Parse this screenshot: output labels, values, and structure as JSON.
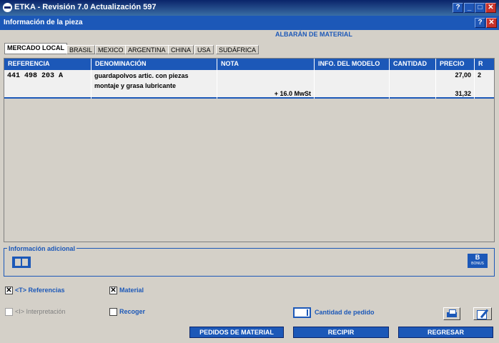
{
  "window": {
    "title": "ETKA - Revisión 7.0 Actualización 597",
    "help": "?",
    "minimize": "_",
    "maximize": "□",
    "close": "✕"
  },
  "dialog": {
    "title": "Información de la pieza",
    "help": "?",
    "close": "✕"
  },
  "section_title": "ALBARÁN DE MATERIAL",
  "tabs": [
    "MERCADO LOCAL",
    "BRASIL",
    "MEXICO",
    "ARGENTINA",
    "CHINA",
    "USA",
    "SUDÁFRICA"
  ],
  "table": {
    "headers": [
      "REFERENCIA",
      "DENOMINACIÓN",
      "NOTA",
      "INFO. DEL MODELO",
      "CANTIDAD",
      "PRECIO",
      "R"
    ],
    "row": {
      "referencia": "441 498 203 A",
      "denominacion_1": "guardapolvos artic. con piezas",
      "denominacion_2": "montaje y grasa lubricante",
      "nota": "+ 16.0 MwSt",
      "info_modelo": "",
      "cantidad": "",
      "precio": "27,00",
      "precio_total": "31,32",
      "r": "2"
    }
  },
  "info_adicional": {
    "label": "Información adicional",
    "bonus": "BONUS"
  },
  "options": {
    "referencias": {
      "label": "<T> Referencias",
      "checked": true
    },
    "material": {
      "label": "Material",
      "checked": true
    },
    "interpretacion": {
      "label": "<I> Interpretación",
      "checked": false
    },
    "recoger": {
      "label": "Recoger",
      "checked": false
    },
    "cantidad_pedido": "Cantidad de pedido"
  },
  "buttons": {
    "pedidos": "PEDIDOS DE MATERIAL",
    "recipir": "RECIPIR",
    "regresar": "REGRESAR"
  },
  "colors": {
    "accent": "#1c58b8",
    "title": "#0a246a",
    "background": "#d4d0c8"
  }
}
